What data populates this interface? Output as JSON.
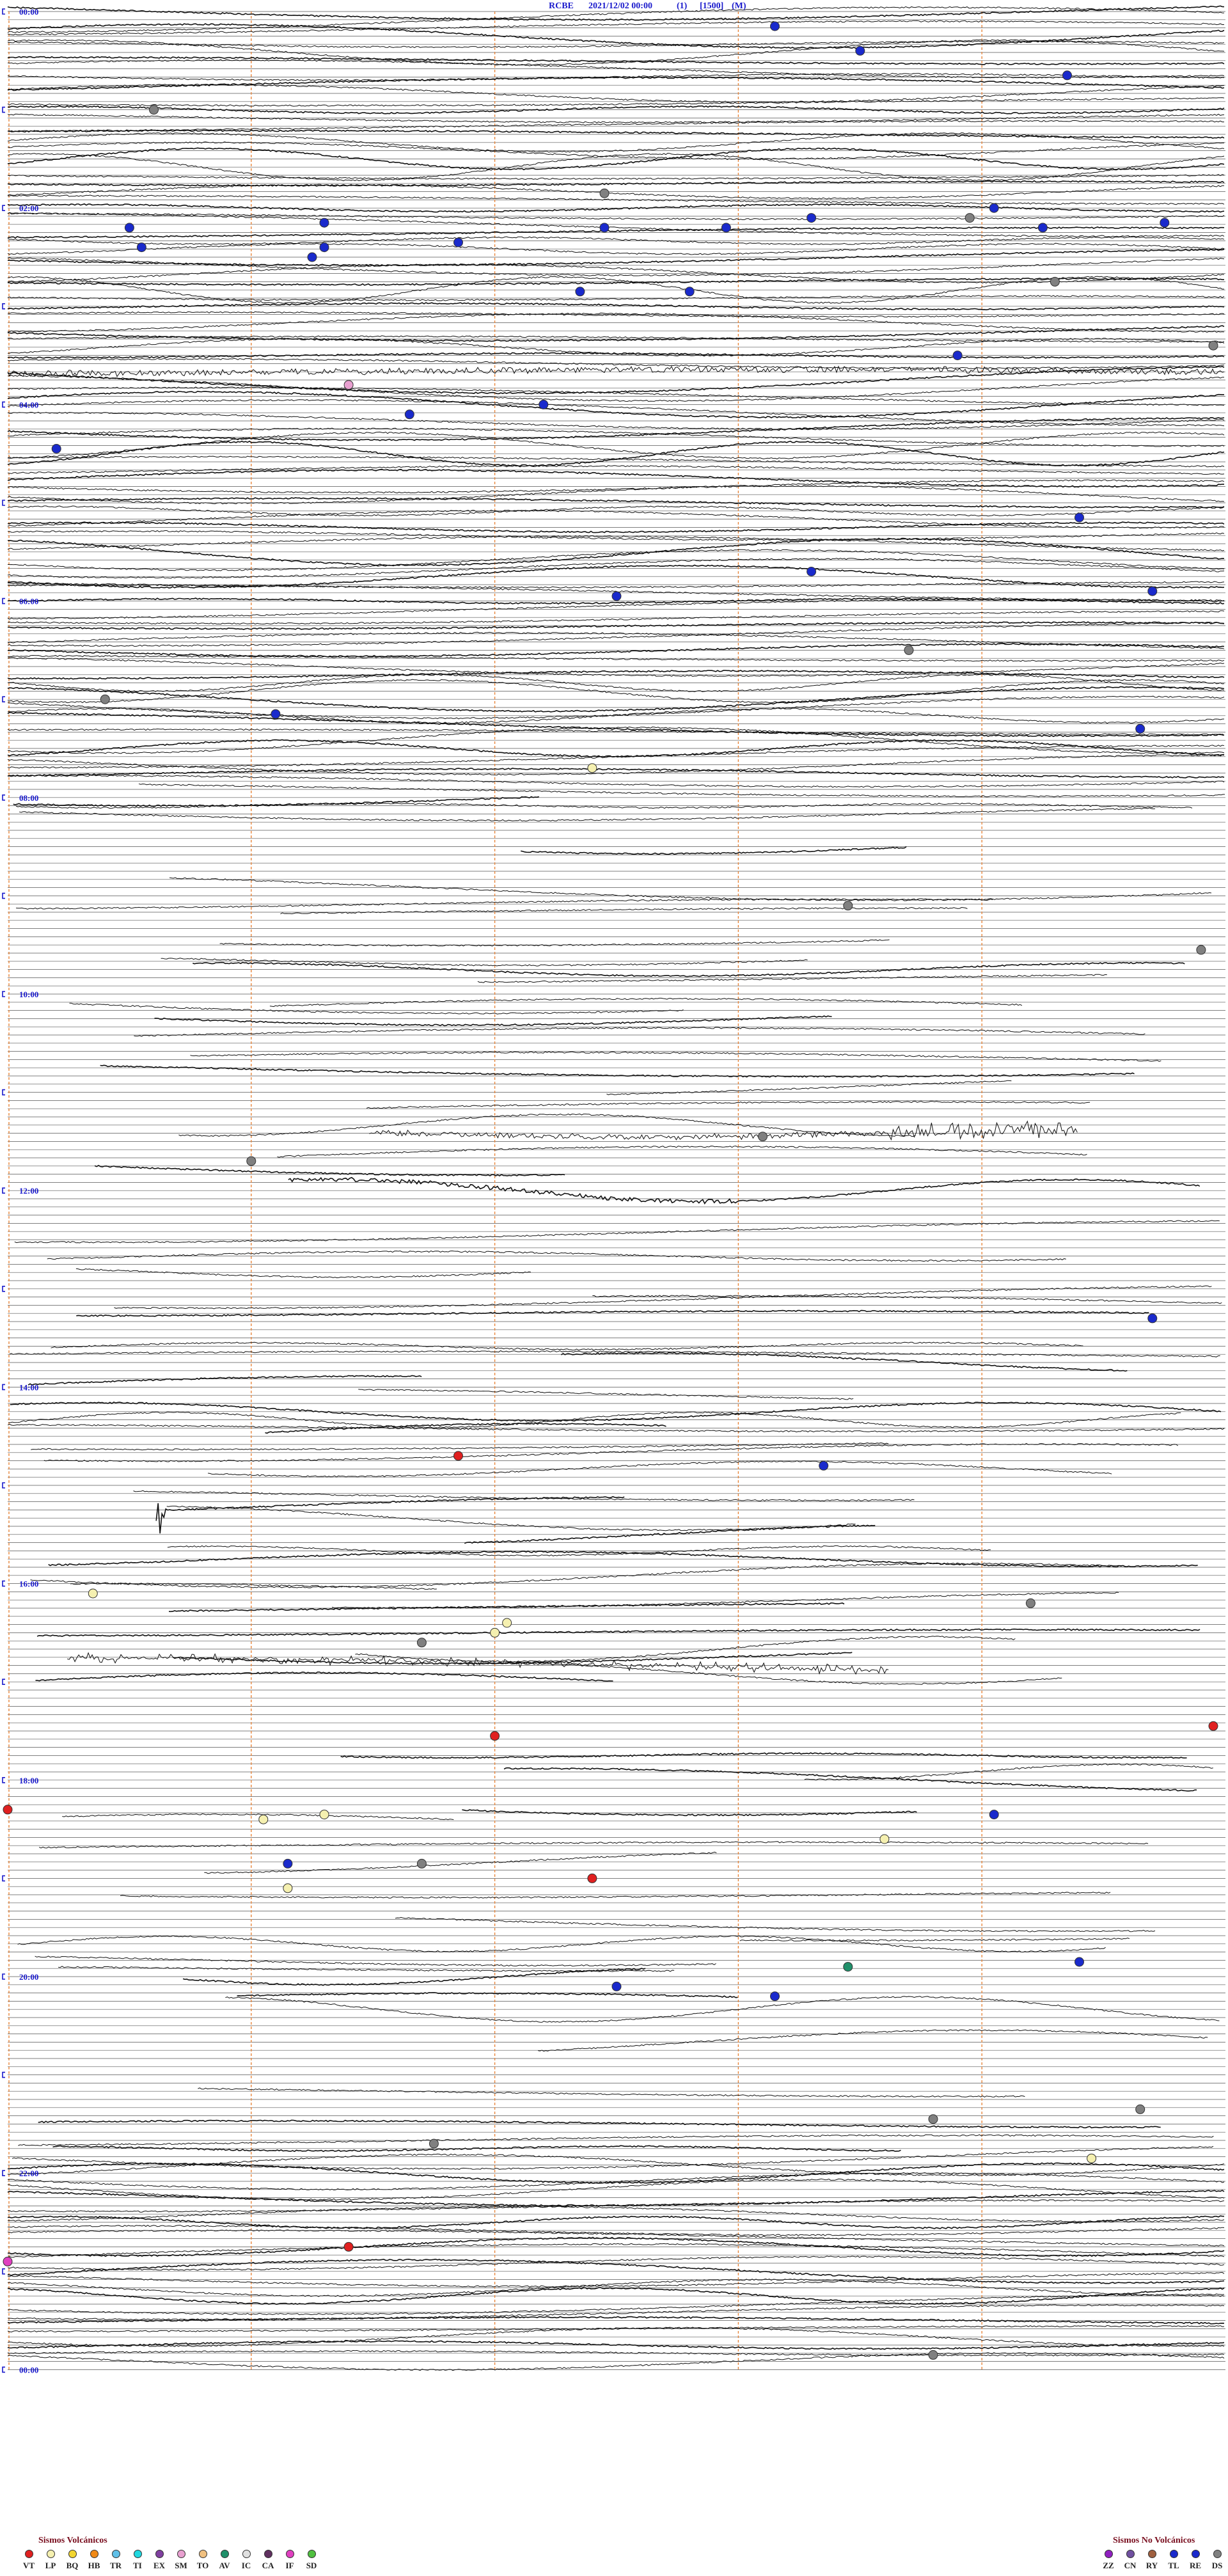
{
  "header": {
    "station": "RCBE",
    "datetime": "2021/12/02 00:00",
    "channel": "(1)",
    "scale": "[1500]",
    "mode": "(M)"
  },
  "chart_data": {
    "type": "helicorder",
    "line_color": "#111111",
    "grid_color": "#555555",
    "minute_marker_color": "#e8873d",
    "time_label_color": "#1a1acc",
    "hour_labels": [
      "00:00",
      "02:00",
      "04:00",
      "06:00",
      "08:00",
      "10:00",
      "12:00",
      "14:00",
      "16:00",
      "18:00",
      "20:00",
      "22:00",
      "00:00"
    ],
    "events": [
      {
        "code": "RE",
        "hour": 0.15,
        "minute": 63
      },
      {
        "code": "RE",
        "hour": 0.4,
        "minute": 70
      },
      {
        "code": "RE",
        "hour": 0.65,
        "minute": 87
      },
      {
        "code": "DS",
        "hour": 1.0,
        "minute": 12
      },
      {
        "code": "DS",
        "hour": 1.85,
        "minute": 49
      },
      {
        "code": "RE",
        "hour": 2.2,
        "minute": 10
      },
      {
        "code": "RE",
        "hour": 2.15,
        "minute": 26
      },
      {
        "code": "RE",
        "hour": 2.2,
        "minute": 49
      },
      {
        "code": "RE",
        "hour": 2.2,
        "minute": 59
      },
      {
        "code": "RE",
        "hour": 2.1,
        "minute": 66
      },
      {
        "code": "DS",
        "hour": 2.1,
        "minute": 79
      },
      {
        "code": "RE",
        "hour": 2.0,
        "minute": 81
      },
      {
        "code": "RE",
        "hour": 2.2,
        "minute": 85
      },
      {
        "code": "RE",
        "hour": 2.15,
        "minute": 95
      },
      {
        "code": "RE",
        "hour": 2.4,
        "minute": 11
      },
      {
        "code": "RE",
        "hour": 2.4,
        "minute": 26
      },
      {
        "code": "RE",
        "hour": 2.5,
        "minute": 25
      },
      {
        "code": "RE",
        "hour": 2.35,
        "minute": 37
      },
      {
        "code": "RE",
        "hour": 2.85,
        "minute": 47
      },
      {
        "code": "RE",
        "hour": 2.85,
        "minute": 56
      },
      {
        "code": "DS",
        "hour": 2.75,
        "minute": 86
      },
      {
        "code": "DS",
        "hour": 3.4,
        "minute": 99
      },
      {
        "code": "RE",
        "hour": 3.5,
        "minute": 78
      },
      {
        "code": "SM",
        "hour": 3.8,
        "minute": 28
      },
      {
        "code": "RE",
        "hour": 4.0,
        "minute": 44
      },
      {
        "code": "RE",
        "hour": 4.1,
        "minute": 33
      },
      {
        "code": "RE",
        "hour": 4.45,
        "minute": 4
      },
      {
        "code": "RE",
        "hour": 5.15,
        "minute": 88
      },
      {
        "code": "RE",
        "hour": 5.7,
        "minute": 66
      },
      {
        "code": "RE",
        "hour": 5.95,
        "minute": 50
      },
      {
        "code": "RE",
        "hour": 5.9,
        "minute": 94
      },
      {
        "code": "DS",
        "hour": 6.5,
        "minute": 74
      },
      {
        "code": "DS",
        "hour": 7.0,
        "minute": 8
      },
      {
        "code": "RE",
        "hour": 7.15,
        "minute": 22
      },
      {
        "code": "RE",
        "hour": 7.3,
        "minute": 93
      },
      {
        "code": "LP",
        "hour": 7.7,
        "minute": 48
      },
      {
        "code": "DS",
        "hour": 9.1,
        "minute": 69
      },
      {
        "code": "DS",
        "hour": 9.55,
        "minute": 98
      },
      {
        "code": "DS",
        "hour": 11.45,
        "minute": 62
      },
      {
        "code": "DS",
        "hour": 11.7,
        "minute": 20
      },
      {
        "code": "RE",
        "hour": 13.3,
        "minute": 94
      },
      {
        "code": "VT",
        "hour": 14.7,
        "minute": 37
      },
      {
        "code": "RE",
        "hour": 14.8,
        "minute": 67
      },
      {
        "code": "LP",
        "hour": 16.1,
        "minute": 7
      },
      {
        "code": "DS",
        "hour": 16.2,
        "minute": 84
      },
      {
        "code": "LP",
        "hour": 16.4,
        "minute": 41
      },
      {
        "code": "LP",
        "hour": 16.5,
        "minute": 40
      },
      {
        "code": "DS",
        "hour": 16.6,
        "minute": 34
      },
      {
        "code": "VT",
        "hour": 17.55,
        "minute": 40
      },
      {
        "code": "VT",
        "hour": 17.45,
        "minute": 99
      },
      {
        "code": "VT",
        "hour": 18.3,
        "minute": 0
      },
      {
        "code": "LP",
        "hour": 18.4,
        "minute": 21
      },
      {
        "code": "LP",
        "hour": 18.35,
        "minute": 26
      },
      {
        "code": "RE",
        "hour": 18.35,
        "minute": 81
      },
      {
        "code": "LP",
        "hour": 18.6,
        "minute": 72
      },
      {
        "code": "RE",
        "hour": 18.85,
        "minute": 23
      },
      {
        "code": "DS",
        "hour": 18.85,
        "minute": 34
      },
      {
        "code": "VT",
        "hour": 19.0,
        "minute": 48
      },
      {
        "code": "LP",
        "hour": 19.1,
        "minute": 23
      },
      {
        "code": "RE",
        "hour": 19.85,
        "minute": 88
      },
      {
        "code": "AV",
        "hour": 19.9,
        "minute": 69
      },
      {
        "code": "RE",
        "hour": 20.1,
        "minute": 50
      },
      {
        "code": "RE",
        "hour": 20.2,
        "minute": 63
      },
      {
        "code": "DS",
        "hour": 21.35,
        "minute": 93
      },
      {
        "code": "DS",
        "hour": 21.45,
        "minute": 76
      },
      {
        "code": "DS",
        "hour": 21.7,
        "minute": 35
      },
      {
        "code": "LP",
        "hour": 21.85,
        "minute": 89
      },
      {
        "code": "VT",
        "hour": 22.75,
        "minute": 28
      },
      {
        "code": "IF",
        "hour": 22.9,
        "minute": 0
      },
      {
        "code": "DS",
        "hour": 23.85,
        "minute": 76
      }
    ]
  },
  "legend": {
    "volcanic": {
      "title": "Sismos Volcánicos",
      "items": [
        {
          "code": "VT",
          "color": "#e02020"
        },
        {
          "code": "LP",
          "color": "#f5f0b0"
        },
        {
          "code": "BQ",
          "color": "#f2d530"
        },
        {
          "code": "HB",
          "color": "#f08a18"
        },
        {
          "code": "TR",
          "color": "#60c0e8"
        },
        {
          "code": "TI",
          "color": "#20d8e0"
        },
        {
          "code": "EX",
          "color": "#8040a0"
        },
        {
          "code": "SM",
          "color": "#e8a0d0"
        },
        {
          "code": "TO",
          "color": "#f0c080"
        },
        {
          "code": "AV",
          "color": "#20906a"
        },
        {
          "code": "IC",
          "color": "#e0e0e0"
        },
        {
          "code": "CA",
          "color": "#603060"
        },
        {
          "code": "IF",
          "color": "#e040c0"
        },
        {
          "code": "SD",
          "color": "#50c040"
        }
      ]
    },
    "non_volcanic": {
      "title": "Sismos No Volcánicos",
      "items": [
        {
          "code": "ZZ",
          "color": "#9020c0"
        },
        {
          "code": "CN",
          "color": "#7050a0"
        },
        {
          "code": "RY",
          "color": "#a06040"
        },
        {
          "code": "TL",
          "color": "#1a2acc"
        },
        {
          "code": "RE",
          "color": "#1a2acc"
        },
        {
          "code": "DS",
          "color": "#808080"
        }
      ]
    }
  }
}
